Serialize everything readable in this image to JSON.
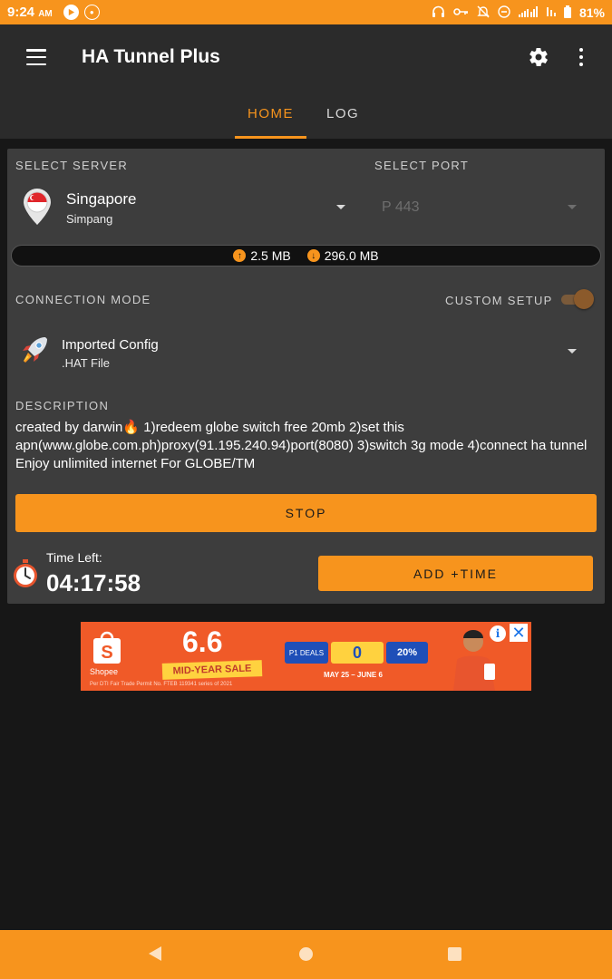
{
  "status_bar": {
    "time": "9:24",
    "time_suffix": "AM",
    "battery": "81%",
    "icons": [
      "play-icon",
      "notification-badge-icon",
      "headset-icon",
      "key-icon",
      "mute-icon",
      "do-not-disturb-icon",
      "signal-icon",
      "wifi-icon",
      "battery-icon"
    ]
  },
  "app_bar": {
    "title": "HA Tunnel Plus",
    "tabs": [
      {
        "label": "HOME",
        "active": true
      },
      {
        "label": "LOG",
        "active": false
      }
    ]
  },
  "server": {
    "label": "SELECT SERVER",
    "name": "Singapore",
    "sub": "Simpang"
  },
  "port": {
    "label": "SELECT PORT",
    "value": "P 443"
  },
  "usage": {
    "upload": "2.5 MB",
    "download": "296.0 MB"
  },
  "connection": {
    "label": "CONNECTION MODE",
    "custom_setup_label": "CUSTOM SETUP",
    "custom_setup_on": true,
    "mode_name": "Imported Config",
    "mode_sub": ".HAT File"
  },
  "description": {
    "label": "DESCRIPTION",
    "text": "created by darwin🔥 1)redeem globe switch free 20mb 2)set this apn(www.globe.com.ph)proxy(91.195.240.94)port(8080) 3)switch 3g mode 4)connect ha tunnel Enjoy unlimited internet For GLOBE/TM"
  },
  "actions": {
    "stop_label": "STOP",
    "time_left_label": "Time Left:",
    "time_left_value": "04:17:58",
    "add_time_label": "ADD +TIME"
  },
  "ad": {
    "brand": "Shopee",
    "headline": "6.6",
    "tag": "MID-YEAR SALE",
    "box1": "P1 DEALS",
    "box2": "0",
    "box3": "20%",
    "date": "MAY 25 – JUNE 6",
    "fine_print": "Per DTI Fair Trade Permit No. FTEB 119341 series of 2021"
  },
  "colors": {
    "accent": "#f7941d",
    "background": "#171717",
    "card": "#3d3d3d",
    "app_bar": "#2b2b2b"
  }
}
